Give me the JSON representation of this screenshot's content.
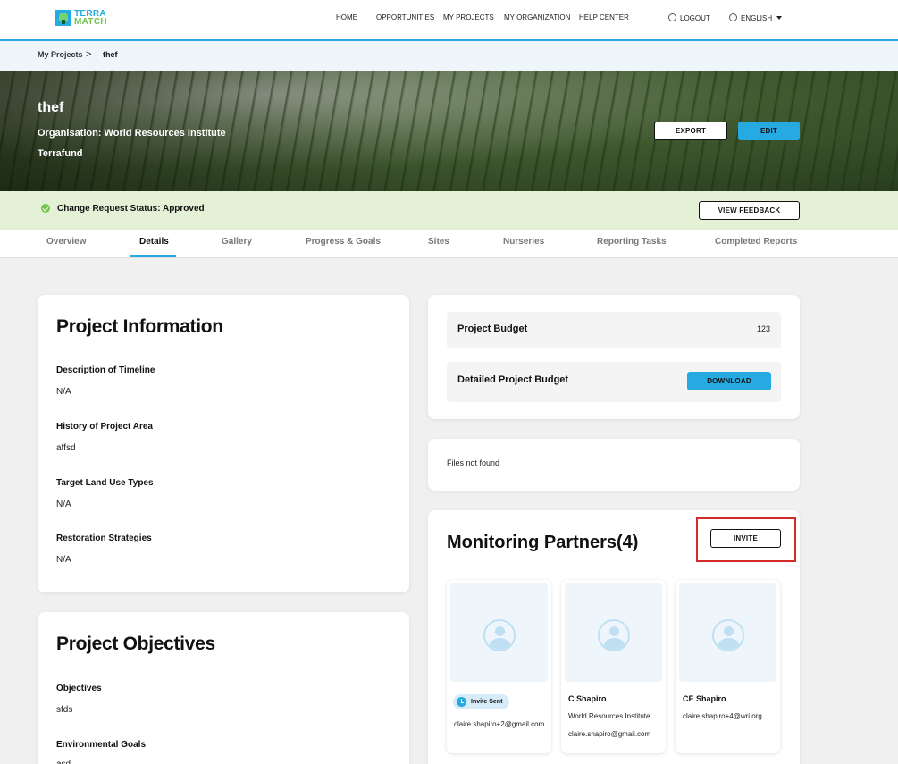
{
  "nav": {
    "logo_line1": "TERRA",
    "logo_line2": "MATCH",
    "home": "HOME",
    "opportunities": "OPPORTUNITIES",
    "my_projects": "MY PROJECTS",
    "my_organization": "MY ORGANIZATION",
    "help_center": "HELP CENTER",
    "logout": "LOGOUT",
    "language": "ENGLISH"
  },
  "breadcrumb": {
    "root": "My Projects",
    "separator": ">",
    "current": "thef"
  },
  "hero": {
    "title": "thef",
    "organisation": "Organisation: World Resources Institute",
    "fund": "Terrafund",
    "export_label": "EXPORT",
    "edit_label": "EDIT"
  },
  "status": {
    "text": "Change Request Status: Approved",
    "feedback_label": "VIEW FEEDBACK"
  },
  "tabs": [
    "Overview",
    "Details",
    "Gallery",
    "Progress & Goals",
    "Sites",
    "Nurseries",
    "Reporting Tasks",
    "Completed Reports"
  ],
  "active_tab": "Details",
  "project_information": {
    "title": "Project Information",
    "fields": [
      {
        "label": "Description of Timeline",
        "value": "N/A"
      },
      {
        "label": "History of Project Area",
        "value": "affsd"
      },
      {
        "label": "Target Land Use Types",
        "value": "N/A"
      },
      {
        "label": "Restoration Strategies",
        "value": "N/A"
      }
    ]
  },
  "project_objectives": {
    "title": "Project Objectives",
    "fields": [
      {
        "label": "Objectives",
        "value": "sfds"
      },
      {
        "label": "Environmental Goals",
        "value": "asd"
      }
    ]
  },
  "budget": {
    "project_budget_label": "Project Budget",
    "project_budget_value": "123",
    "detailed_label": "Detailed Project Budget",
    "download_label": "DOWNLOAD"
  },
  "files": {
    "empty_text": "Files not found"
  },
  "partners": {
    "title": "Monitoring Partners(4)",
    "invite_label": "INVITE",
    "items": [
      {
        "badge": "Invite Sent",
        "email": "claire.shapiro+2@gmail.com"
      },
      {
        "name": "C Shapiro",
        "org": "World Resources Institute",
        "email": "claire.shapiro@gmail.com"
      },
      {
        "name": "CE Shapiro",
        "email": "claire.shapiro+4@wri.org"
      }
    ]
  },
  "colors": {
    "accent": "#27a9e1",
    "status_bg": "#e5f1d7",
    "success": "#72c44f",
    "highlight": "#d42a2a"
  }
}
